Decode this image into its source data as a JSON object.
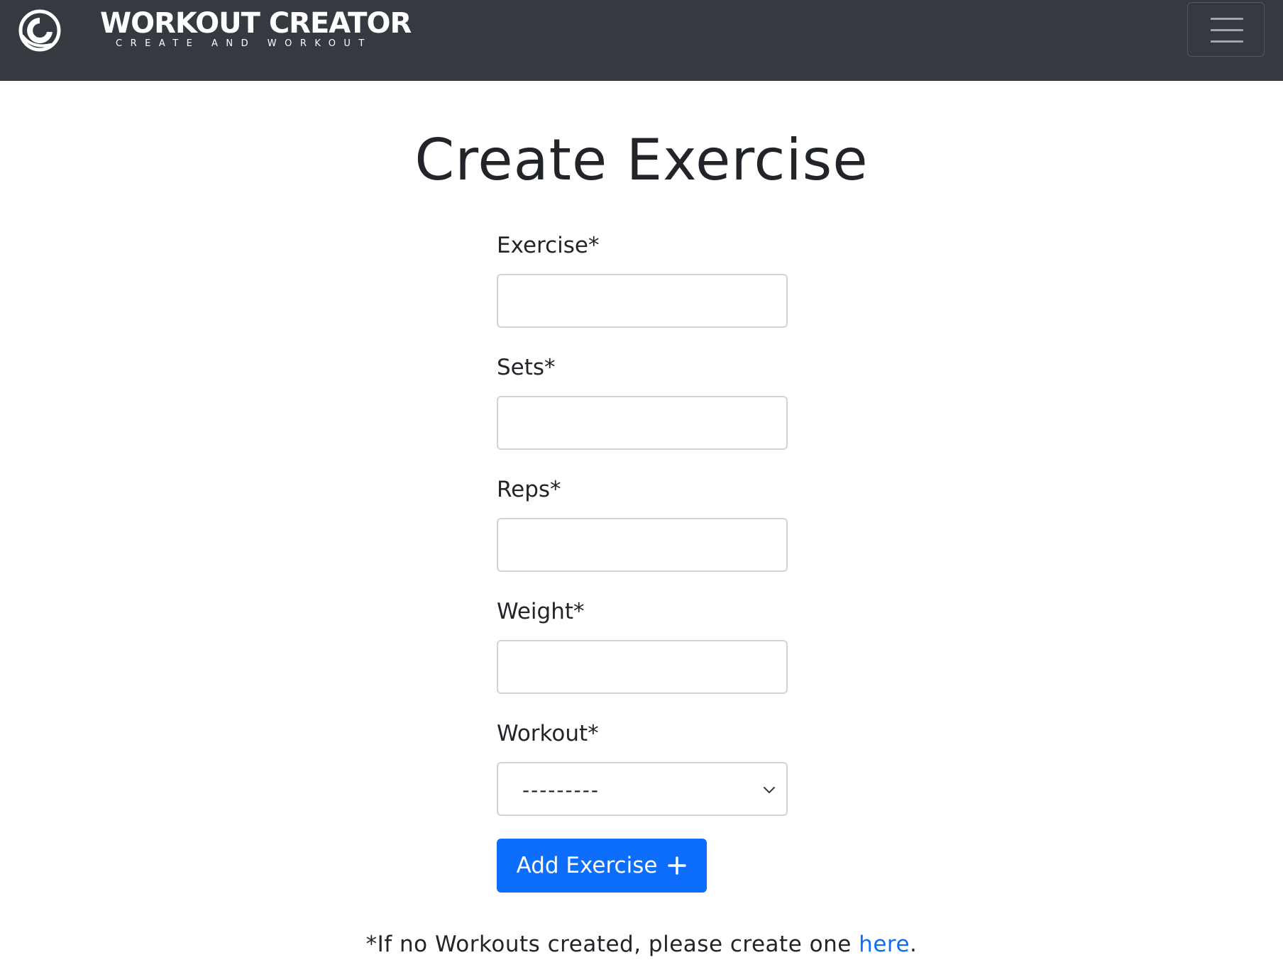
{
  "navbar": {
    "brand_title": "WORKOUT CREATOR",
    "brand_tagline": "CREATE AND WORKOUT",
    "logo_icon": "swirl-logo-icon",
    "menu_icon": "hamburger-menu-icon",
    "background_color": "#343a40"
  },
  "page": {
    "title": "Create Exercise"
  },
  "form": {
    "exercise": {
      "label": "Exercise*",
      "value": ""
    },
    "sets": {
      "label": "Sets*",
      "value": ""
    },
    "reps": {
      "label": "Reps*",
      "value": ""
    },
    "weight": {
      "label": "Weight*",
      "value": ""
    },
    "workout": {
      "label": "Workout*",
      "selected": "---------",
      "icon": "chevron-down-icon"
    },
    "submit": {
      "label": "Add Exercise",
      "icon": "plus-icon",
      "color": "#0d6efd"
    }
  },
  "footnote": {
    "text_before": "*If no Workouts created, please create one ",
    "link_text": "here",
    "text_after": ".",
    "link_color": "#0d6efd"
  }
}
